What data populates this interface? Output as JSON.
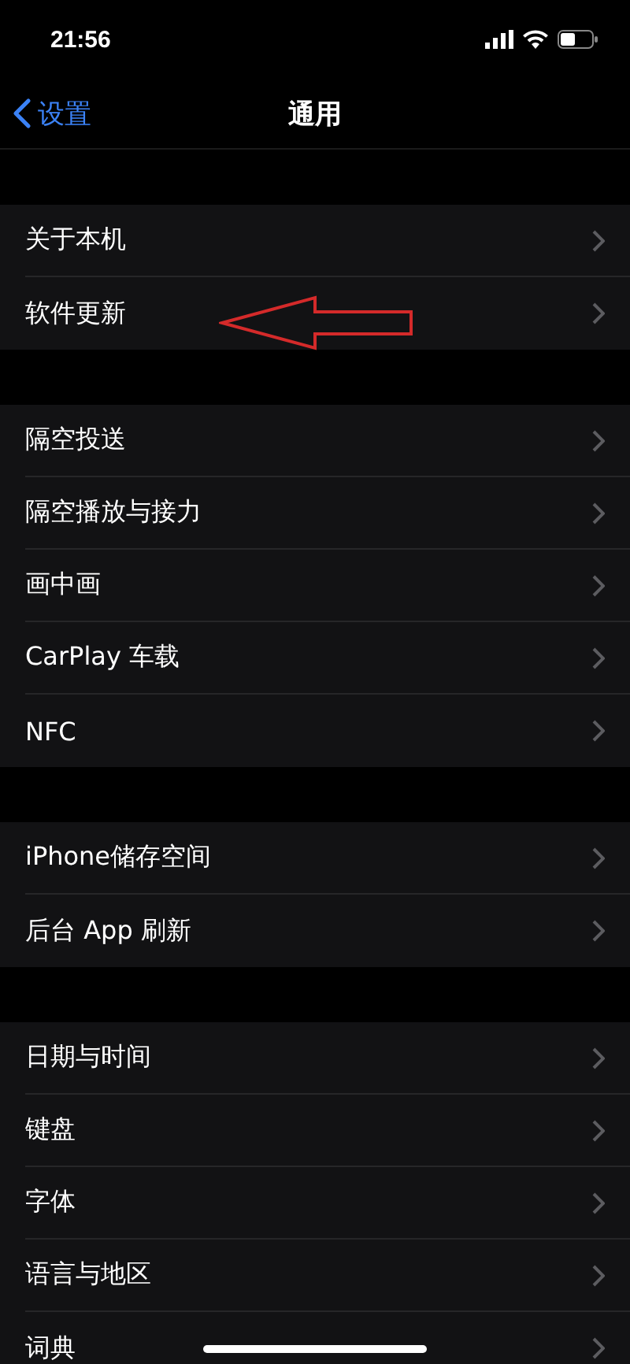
{
  "status_bar": {
    "time": "21:56"
  },
  "nav": {
    "back": "设置",
    "title": "通用"
  },
  "groups": [
    {
      "rows": [
        {
          "label": "关于本机"
        },
        {
          "label": "软件更新"
        }
      ]
    },
    {
      "rows": [
        {
          "label": "隔空投送"
        },
        {
          "label": "隔空播放与接力"
        },
        {
          "label": "画中画"
        },
        {
          "label": "CarPlay 车载"
        },
        {
          "label": "NFC"
        }
      ]
    },
    {
      "rows": [
        {
          "label": "iPhone储存空间"
        },
        {
          "label": "后台 App 刷新"
        }
      ]
    },
    {
      "rows": [
        {
          "label": "日期与时间"
        },
        {
          "label": "键盘"
        },
        {
          "label": "字体"
        },
        {
          "label": "语言与地区"
        },
        {
          "label": "词典"
        }
      ]
    }
  ]
}
